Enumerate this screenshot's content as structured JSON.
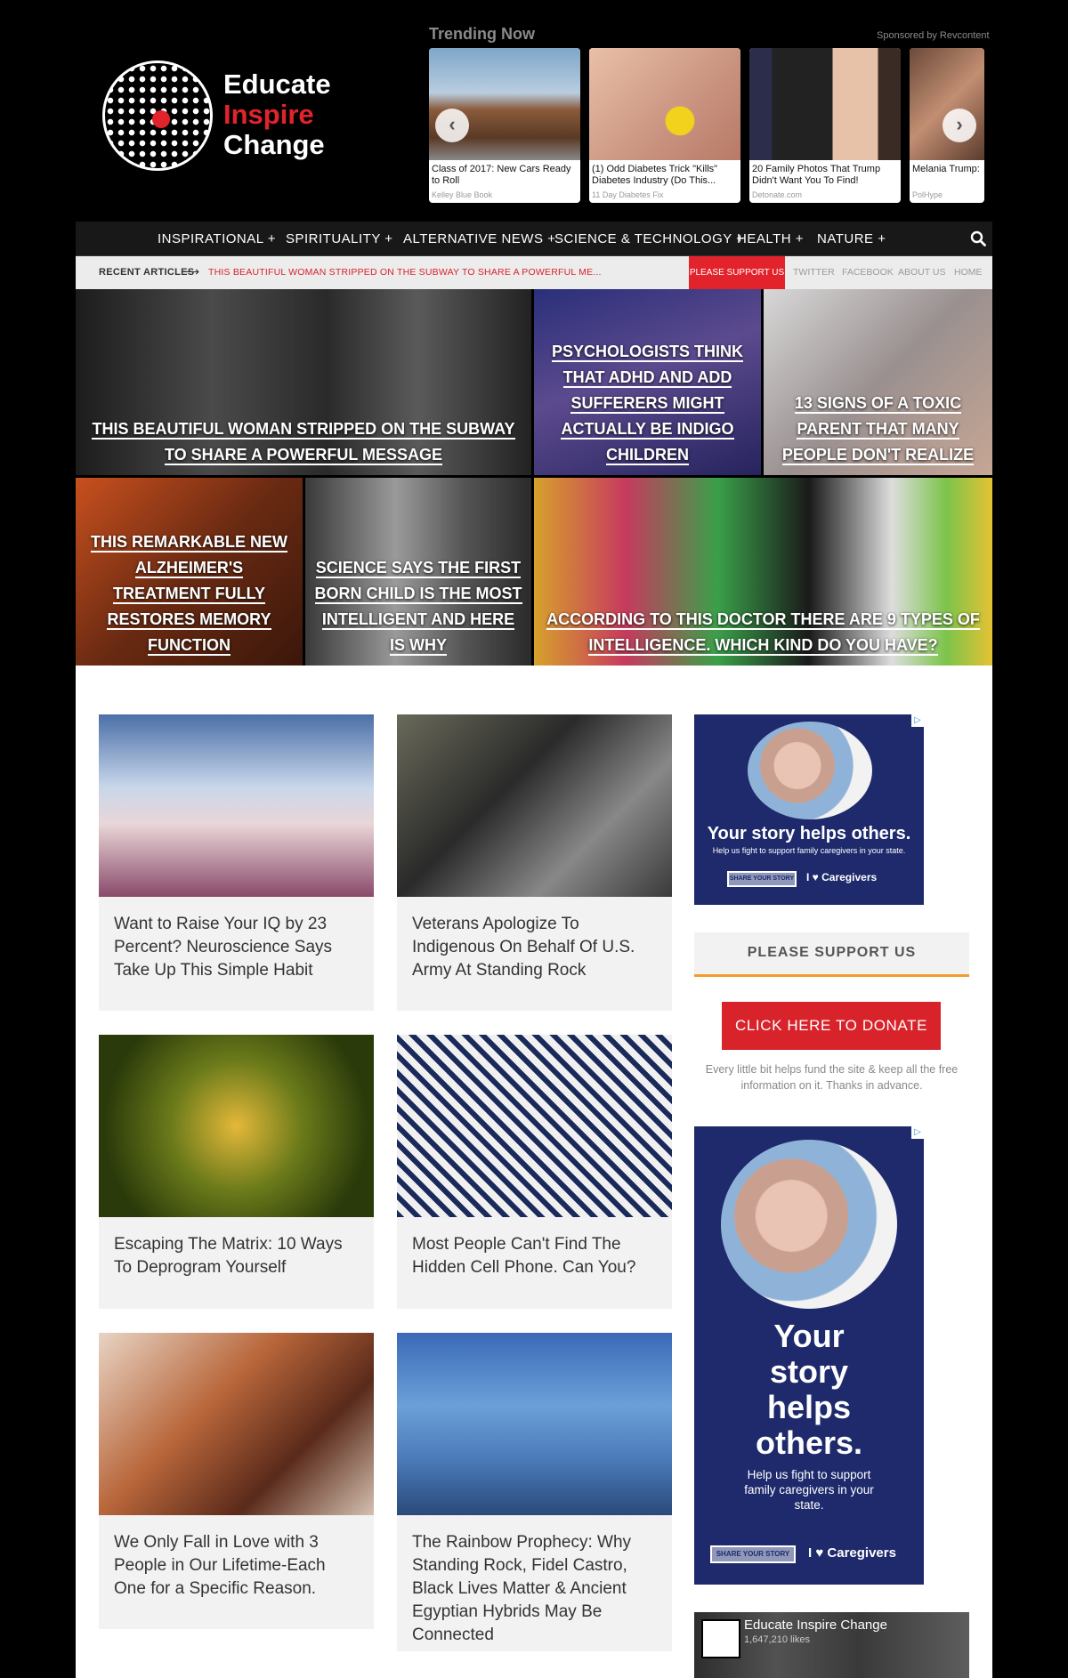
{
  "logo": {
    "line1": "Educate",
    "line2": "Inspire",
    "line3": "Change"
  },
  "trending": {
    "title": "Trending Now",
    "sponsor": "Sponsored by Revcontent",
    "items": [
      {
        "caption": "Class of 2017: New Cars Ready to Roll",
        "source": "Kelley Blue Book"
      },
      {
        "caption": "(1) Odd Diabetes Trick \"Kills\" Diabetes Industry (Do This...",
        "source": "11 Day Diabetes Fix"
      },
      {
        "caption": "20 Family Photos That Trump Didn't Want You To Find!",
        "source": "Detonate.com"
      },
      {
        "caption": "Melania Trump: Photos Will Hav",
        "source": "PolHype"
      }
    ],
    "prev": "‹",
    "next": "›"
  },
  "nav": {
    "items": [
      "INSPIRATIONAL +",
      "SPIRITUALITY +",
      "ALTERNATIVE NEWS +",
      "SCIENCE & TECHNOLOGY +",
      "HEALTH +",
      "NATURE +"
    ]
  },
  "subbar": {
    "recent_label": "RECENT ARTICLES",
    "arrow": "⟶",
    "headline": "THIS BEAUTIFUL WOMAN STRIPPED ON THE SUBWAY TO SHARE A POWERFUL ME...",
    "support": "PLEASE SUPPORT US",
    "links": [
      "TWITTER",
      "FACEBOOK",
      "ABOUT US",
      "HOME"
    ]
  },
  "hero": [
    {
      "title": "This Beautiful Woman Stripped On The Subway To Share A Powerful Message"
    },
    {
      "title": "Psychologists Think That ADHD And ADD Sufferers Might Actually Be Indigo Children"
    },
    {
      "title": "13 Signs Of A Toxic Parent That Many People Don't Realize"
    },
    {
      "title": "This Remarkable New Alzheimer's Treatment Fully Restores Memory Function"
    },
    {
      "title": "Science Says The First Born Child Is The Most Intelligent And Here Is Why"
    },
    {
      "title": "According To This Doctor There Are 9 Types Of Intelligence. Which Kind Do You Have?"
    }
  ],
  "articles": [
    {
      "title": "Want to Raise Your IQ by 23 Percent? Neuroscience Says Take Up This Simple Habit"
    },
    {
      "title": "Veterans Apologize To Indigenous On Behalf Of U.S. Army At Standing Rock"
    },
    {
      "title": "Escaping The Matrix: 10 Ways To Deprogram Yourself"
    },
    {
      "title": "Most People Can't Find The Hidden Cell Phone. Can You?"
    },
    {
      "title": "We Only Fall in Love with 3 People in Our Lifetime-Each One for a Specific Reason."
    },
    {
      "title": "The Rainbow Prophecy: Why Standing Rock, Fidel Castro, Black Lives Matter & Ancient Egyptian Hybrids May Be Connected"
    }
  ],
  "sidebar": {
    "ad1": {
      "headline": "Your story helps others.",
      "sub": "Help us fight to support family caregivers in your state.",
      "button": "SHARE YOUR STORY",
      "brand": "I ♥ Caregivers",
      "choice": "▷"
    },
    "support_title": "PLEASE SUPPORT US",
    "donate": "CLICK HERE TO DONATE",
    "donate_text": "Every little bit helps fund the site & keep all the free information on it. Thanks in advance.",
    "ad2": {
      "headline_1": "Your",
      "headline_2": "story",
      "headline_3": "helps",
      "headline_4": "others.",
      "sub": "Help us fight to support family caregivers in your state.",
      "button": "SHARE YOUR STORY",
      "brand": "I ♥ Caregivers",
      "choice": "▷"
    },
    "fb": {
      "name": "Educate Inspire Change",
      "likes": "1,647,210 likes"
    }
  },
  "colors": {
    "accent_red": "#e3232c",
    "accent_orange": "#f39b2c",
    "ad_blue": "#1e2a6c"
  }
}
